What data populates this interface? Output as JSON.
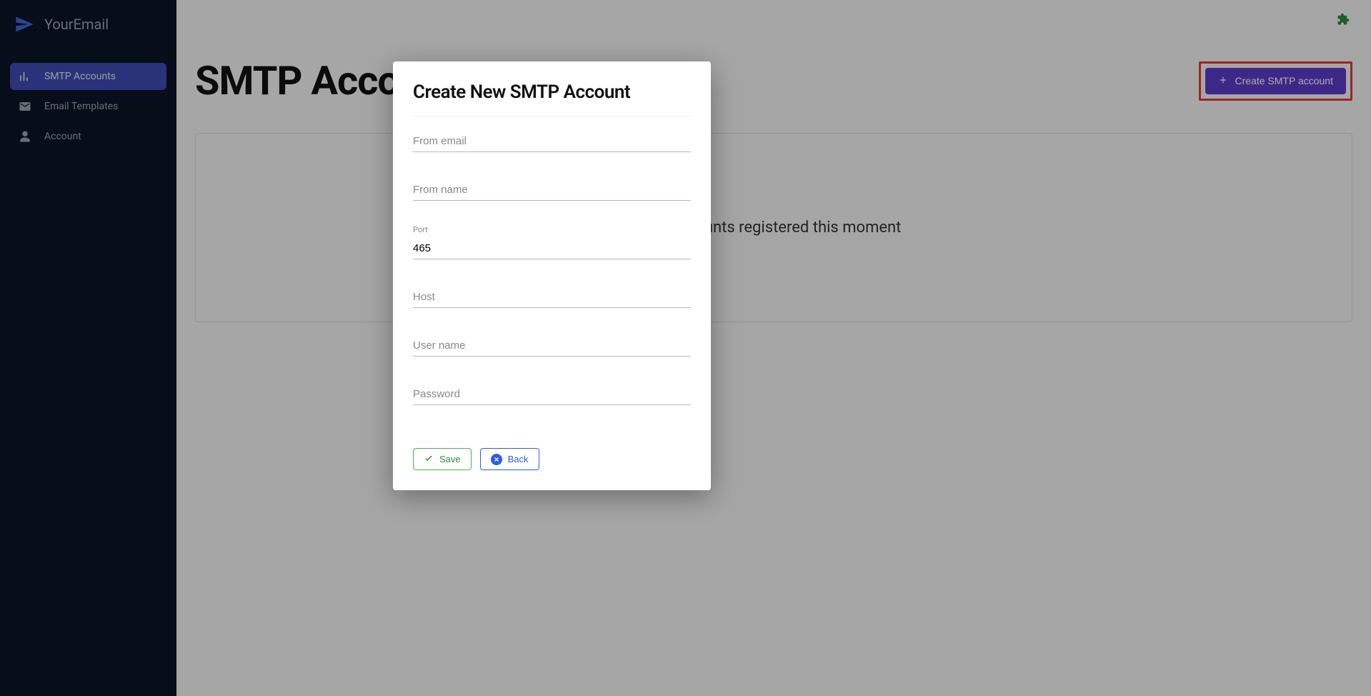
{
  "app": {
    "name": "YourEmail"
  },
  "sidebar": {
    "items": [
      {
        "label": "SMTP Accounts",
        "icon": "bar-chart-icon",
        "active": true
      },
      {
        "label": "Email Templates",
        "icon": "mail-icon",
        "active": false
      },
      {
        "label": "Account",
        "icon": "person-icon",
        "active": false
      }
    ]
  },
  "page": {
    "title": "SMTP Accounts",
    "create_button_label": "Create SMTP account",
    "empty_message": "No accounts registered this moment"
  },
  "modal": {
    "title": "Create New SMTP Account",
    "fields": {
      "from_email": {
        "placeholder": "From email",
        "value": ""
      },
      "from_name": {
        "placeholder": "From name",
        "value": ""
      },
      "port": {
        "label": "Port",
        "value": "465"
      },
      "host": {
        "placeholder": "Host",
        "value": ""
      },
      "user_name": {
        "placeholder": "User name",
        "value": ""
      },
      "password": {
        "placeholder": "Password",
        "value": ""
      }
    },
    "actions": {
      "save_label": "Save",
      "back_label": "Back"
    }
  }
}
